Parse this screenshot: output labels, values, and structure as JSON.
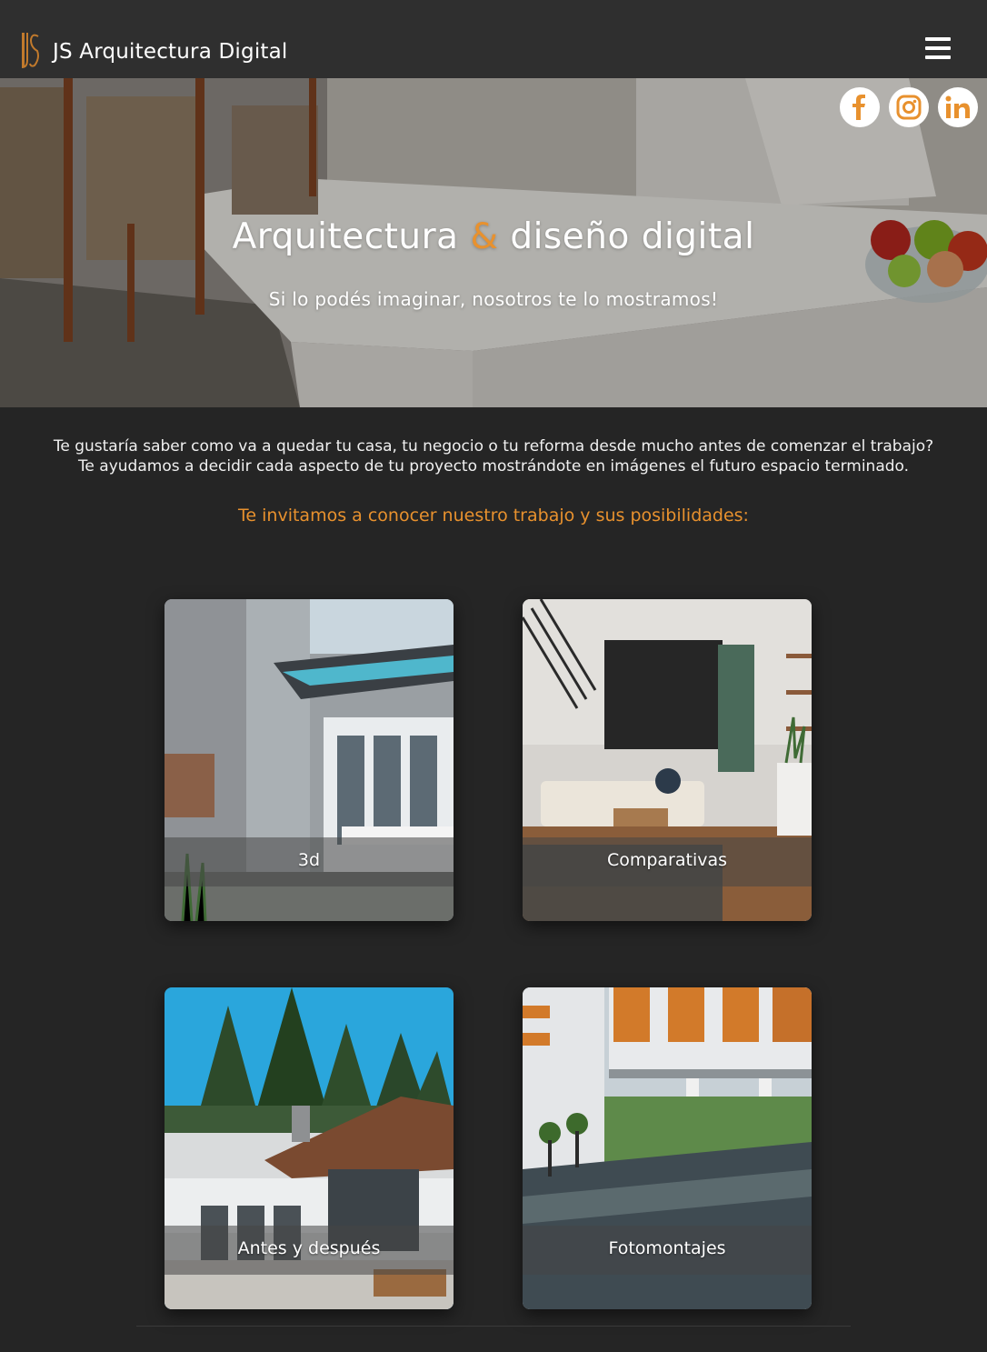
{
  "header": {
    "brand": "JS Arquitectura Digital",
    "logo_icon": "js-monogram-logo",
    "menu_icon": "hamburger-menu-icon"
  },
  "colors": {
    "accent": "#e8912e",
    "background": "#252525",
    "header_bg": "#2f2f2f"
  },
  "hero": {
    "title_part1": "Arquitectura",
    "title_amp": "&",
    "title_part2": "diseño digital",
    "subtitle": "Si lo podés imaginar, nosotros te lo mostramos!"
  },
  "social": [
    {
      "name": "facebook",
      "icon": "facebook-icon"
    },
    {
      "name": "instagram",
      "icon": "instagram-icon"
    },
    {
      "name": "linkedin",
      "icon": "linkedin-icon"
    }
  ],
  "intro": {
    "line1": "Te gustaría saber como va a quedar tu casa, tu negocio o tu reforma desde mucho antes de comenzar el trabajo?",
    "line2": "Te ayudamos a decidir cada aspecto de tu proyecto mostrándote en imágenes el futuro espacio terminado.",
    "invite": "Te invitamos a conocer nuestro trabajo y sus posibilidades:"
  },
  "cards": [
    {
      "label": "3d"
    },
    {
      "label": "Comparativas"
    },
    {
      "label": "Antes y después"
    },
    {
      "label": "Fotomontajes"
    }
  ]
}
